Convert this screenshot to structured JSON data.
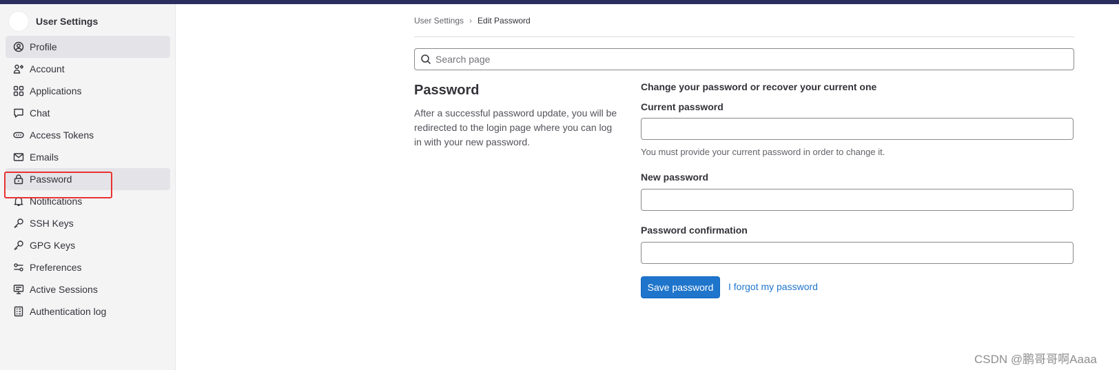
{
  "sidebar": {
    "title": "User Settings",
    "items": [
      {
        "label": "Profile",
        "icon": "profile-icon",
        "active": true
      },
      {
        "label": "Account",
        "icon": "account-icon"
      },
      {
        "label": "Applications",
        "icon": "applications-icon"
      },
      {
        "label": "Chat",
        "icon": "chat-icon"
      },
      {
        "label": "Access Tokens",
        "icon": "token-icon"
      },
      {
        "label": "Emails",
        "icon": "mail-icon"
      },
      {
        "label": "Password",
        "icon": "lock-icon",
        "active": true
      },
      {
        "label": "Notifications",
        "icon": "bell-icon"
      },
      {
        "label": "SSH Keys",
        "icon": "key-icon"
      },
      {
        "label": "GPG Keys",
        "icon": "key-icon"
      },
      {
        "label": "Preferences",
        "icon": "preferences-icon"
      },
      {
        "label": "Active Sessions",
        "icon": "monitor-icon"
      },
      {
        "label": "Authentication log",
        "icon": "log-icon"
      }
    ]
  },
  "breadcrumb": {
    "root": "User Settings",
    "current": "Edit Password"
  },
  "search": {
    "placeholder": "Search page"
  },
  "section": {
    "title": "Password",
    "description": "After a successful password update, you will be redirected to the login page where you can log in with your new password."
  },
  "form": {
    "heading": "Change your password or recover your current one",
    "current_label": "Current password",
    "current_help": "You must provide your current password in order to change it.",
    "new_label": "New password",
    "confirm_label": "Password confirmation",
    "save_label": "Save password",
    "forgot_label": "I forgot my password"
  },
  "watermark": "CSDN @鹏哥哥啊Aaaa",
  "colors": {
    "topbar": "#2b2d5e",
    "primary": "#1f75cb",
    "highlight": "#e8312f"
  }
}
